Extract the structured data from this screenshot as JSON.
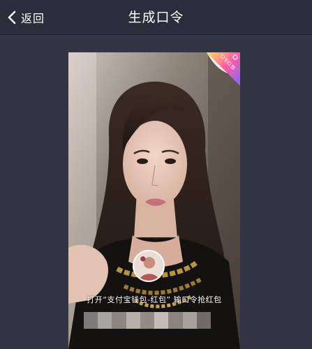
{
  "navbar": {
    "back_label": "返回",
    "title": "生成口令"
  },
  "card": {
    "instruction": "打开“支付宝钱包-红包”  输口令抢红包",
    "corner_badge_text": "口令红包",
    "code_mask_colors": [
      "#7d7a7b",
      "#a8a4a2",
      "#8b8481",
      "#b5aea9",
      "#938b85",
      "#c4bcb5",
      "#8a8380",
      "#a7a19d",
      "#6f6a68"
    ]
  },
  "colors": {
    "background": "#333544",
    "navbar": "#2b2d3a",
    "text": "#ffffff"
  }
}
